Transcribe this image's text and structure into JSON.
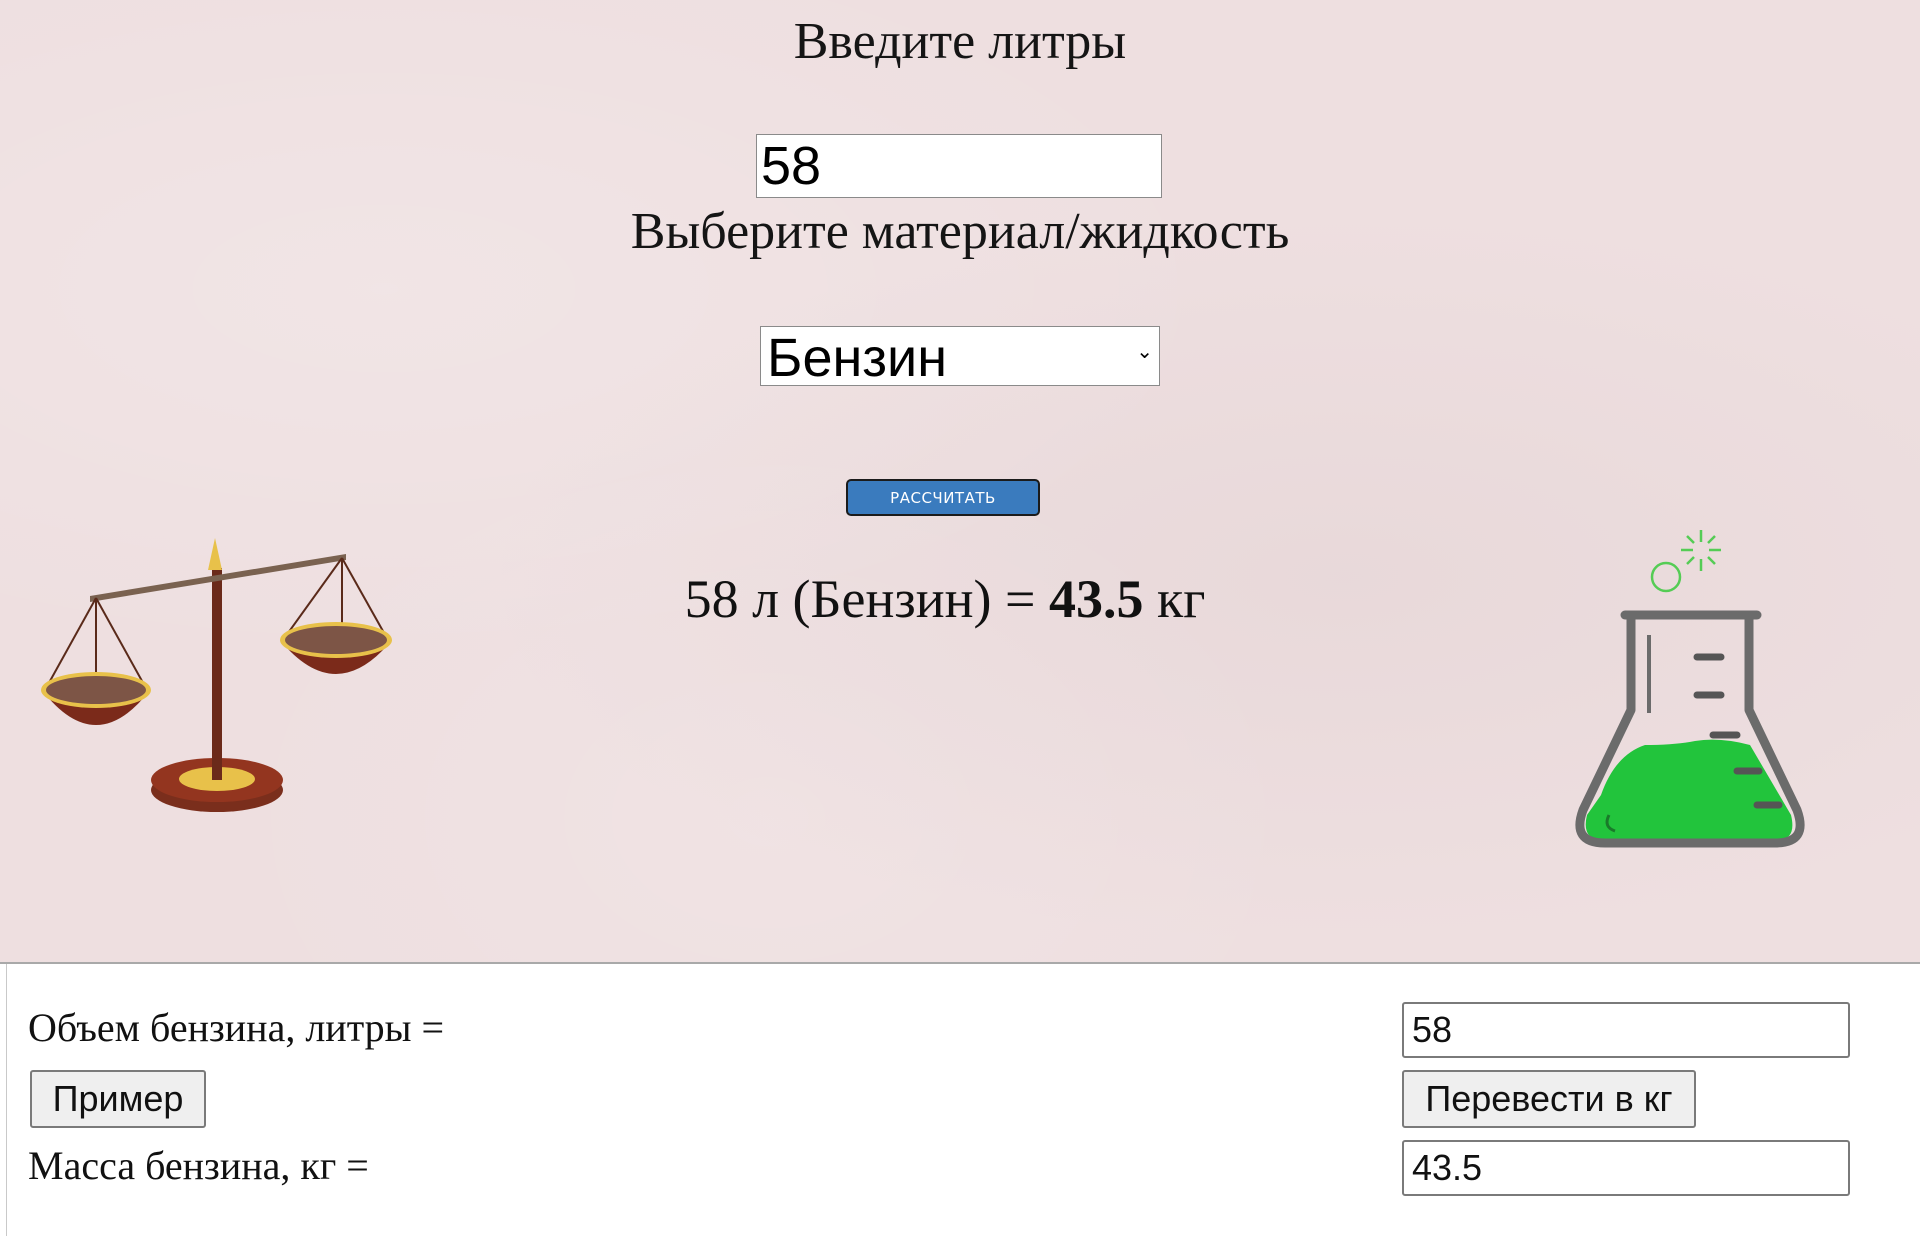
{
  "converter": {
    "liters_heading": "Введите литры",
    "liters_value": "58",
    "material_heading": "Выберите материал/жидкость",
    "material_selected": "Бензин",
    "calculate_label": "РАССЧИТАТЬ",
    "result": {
      "left": "58 л (Бензин) = ",
      "mass": "43.5",
      "unit": " кг"
    }
  },
  "calculator": {
    "volume_label": "Объем бензина, литры =",
    "volume_value": "58",
    "example_label": "Пример",
    "convert_label": "Перевести в кг",
    "mass_label": "Масса бензина, кг =",
    "mass_value": "43.5"
  },
  "illustrations": {
    "left_icon": "balance-scales-icon",
    "right_icon": "chemistry-flask-icon",
    "flask_liquid_color": "#22c43c",
    "scales_color": "#6b2a1a",
    "accent_gold": "#e8c14a"
  },
  "colors": {
    "panel_background": "#eedfe0",
    "button_blue": "#3a7bbe"
  }
}
